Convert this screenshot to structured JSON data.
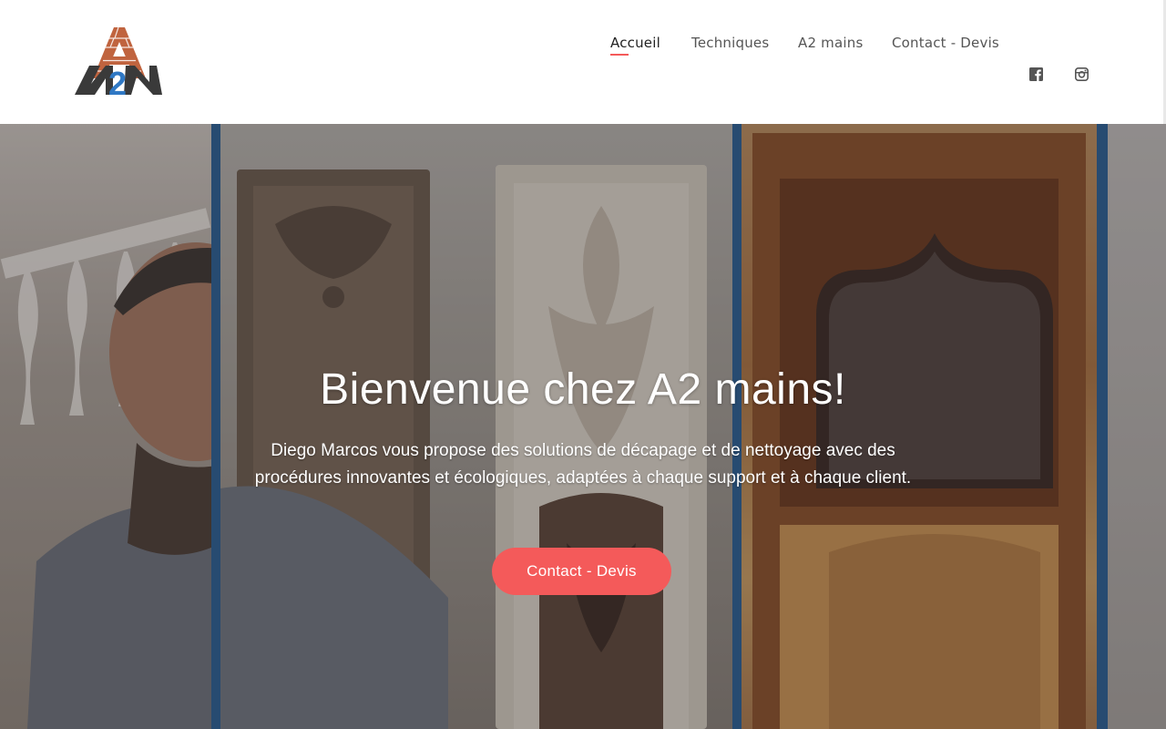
{
  "brand": {
    "logo_text": "A2M",
    "colors": {
      "brick": "#c0643f",
      "blue": "#2f78c4",
      "dark": "#3a3a3a"
    }
  },
  "nav": {
    "items": [
      {
        "label": "Accueil",
        "active": true
      },
      {
        "label": "Techniques",
        "active": false
      },
      {
        "label": "A2 mains",
        "active": false
      },
      {
        "label": "Contact - Devis",
        "active": false
      }
    ],
    "social": [
      {
        "icon": "facebook-icon"
      },
      {
        "icon": "instagram-icon"
      }
    ],
    "active_underline_color": "#f45a5a"
  },
  "hero": {
    "title": "Bienvenue chez A2 mains!",
    "text": "Diego Marcos vous propose des solutions de décapage et de nettoyage avec des procédures innovantes et écologiques, adaptées à chaque support et à chaque client.",
    "cta_label": "Contact - Devis",
    "cta_color": "#f45a5a",
    "strip_color": "#2c5e8e"
  }
}
